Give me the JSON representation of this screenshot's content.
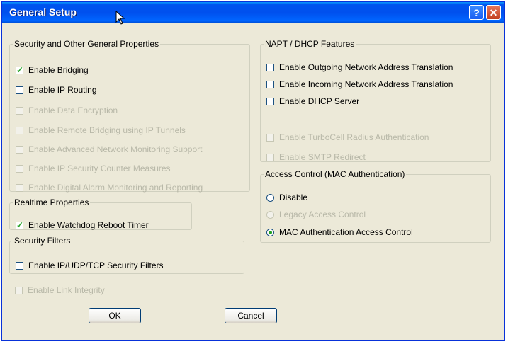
{
  "window": {
    "title": "General Setup",
    "help_label": "?",
    "close_label": "✕"
  },
  "security_group": {
    "legend": "Security and Other General Properties",
    "items": [
      {
        "label": "Enable Bridging",
        "checked": true,
        "enabled": true
      },
      {
        "label": "Enable IP Routing",
        "checked": false,
        "enabled": true
      },
      {
        "label": "Enable Data Encryption",
        "checked": false,
        "enabled": false
      },
      {
        "label": "Enable Remote Bridging using IP Tunnels",
        "checked": false,
        "enabled": false
      },
      {
        "label": "Enable Advanced Network Monitoring Support",
        "checked": false,
        "enabled": false
      },
      {
        "label": "Enable IP Security Counter Measures",
        "checked": false,
        "enabled": false
      },
      {
        "label": "Enable Digital Alarm Monitoring and Reporting",
        "checked": false,
        "enabled": false
      }
    ]
  },
  "realtime_group": {
    "legend": "Realtime Properties",
    "items": [
      {
        "label": "Enable Watchdog Reboot Timer",
        "checked": true,
        "enabled": true
      }
    ]
  },
  "filters_group": {
    "legend": "Security Filters",
    "items": [
      {
        "label": "Enable IP/UDP/TCP Security Filters",
        "checked": false,
        "enabled": true
      }
    ]
  },
  "link_integrity": {
    "label": "Enable Link Integrity",
    "checked": false,
    "enabled": false
  },
  "napt_group": {
    "legend": "NAPT / DHCP Features",
    "items": [
      {
        "label": "Enable Outgoing Network Address Translation",
        "checked": false,
        "enabled": true
      },
      {
        "label": "Enable Incoming Network Address Translation",
        "checked": false,
        "enabled": true
      },
      {
        "label": "Enable DHCP Server",
        "checked": false,
        "enabled": true
      },
      {
        "label": "Enable TurboCell Radius Authentication",
        "checked": false,
        "enabled": false
      },
      {
        "label": "Enable SMTP Redirect",
        "checked": false,
        "enabled": false
      }
    ]
  },
  "access_group": {
    "legend": "Access Control (MAC Authentication)",
    "options": [
      {
        "label": "Disable",
        "selected": false,
        "enabled": true
      },
      {
        "label": "Legacy Access Control",
        "selected": false,
        "enabled": false
      },
      {
        "label": "MAC Authentication Access Control",
        "selected": true,
        "enabled": true
      }
    ]
  },
  "buttons": {
    "ok": "OK",
    "cancel": "Cancel"
  }
}
